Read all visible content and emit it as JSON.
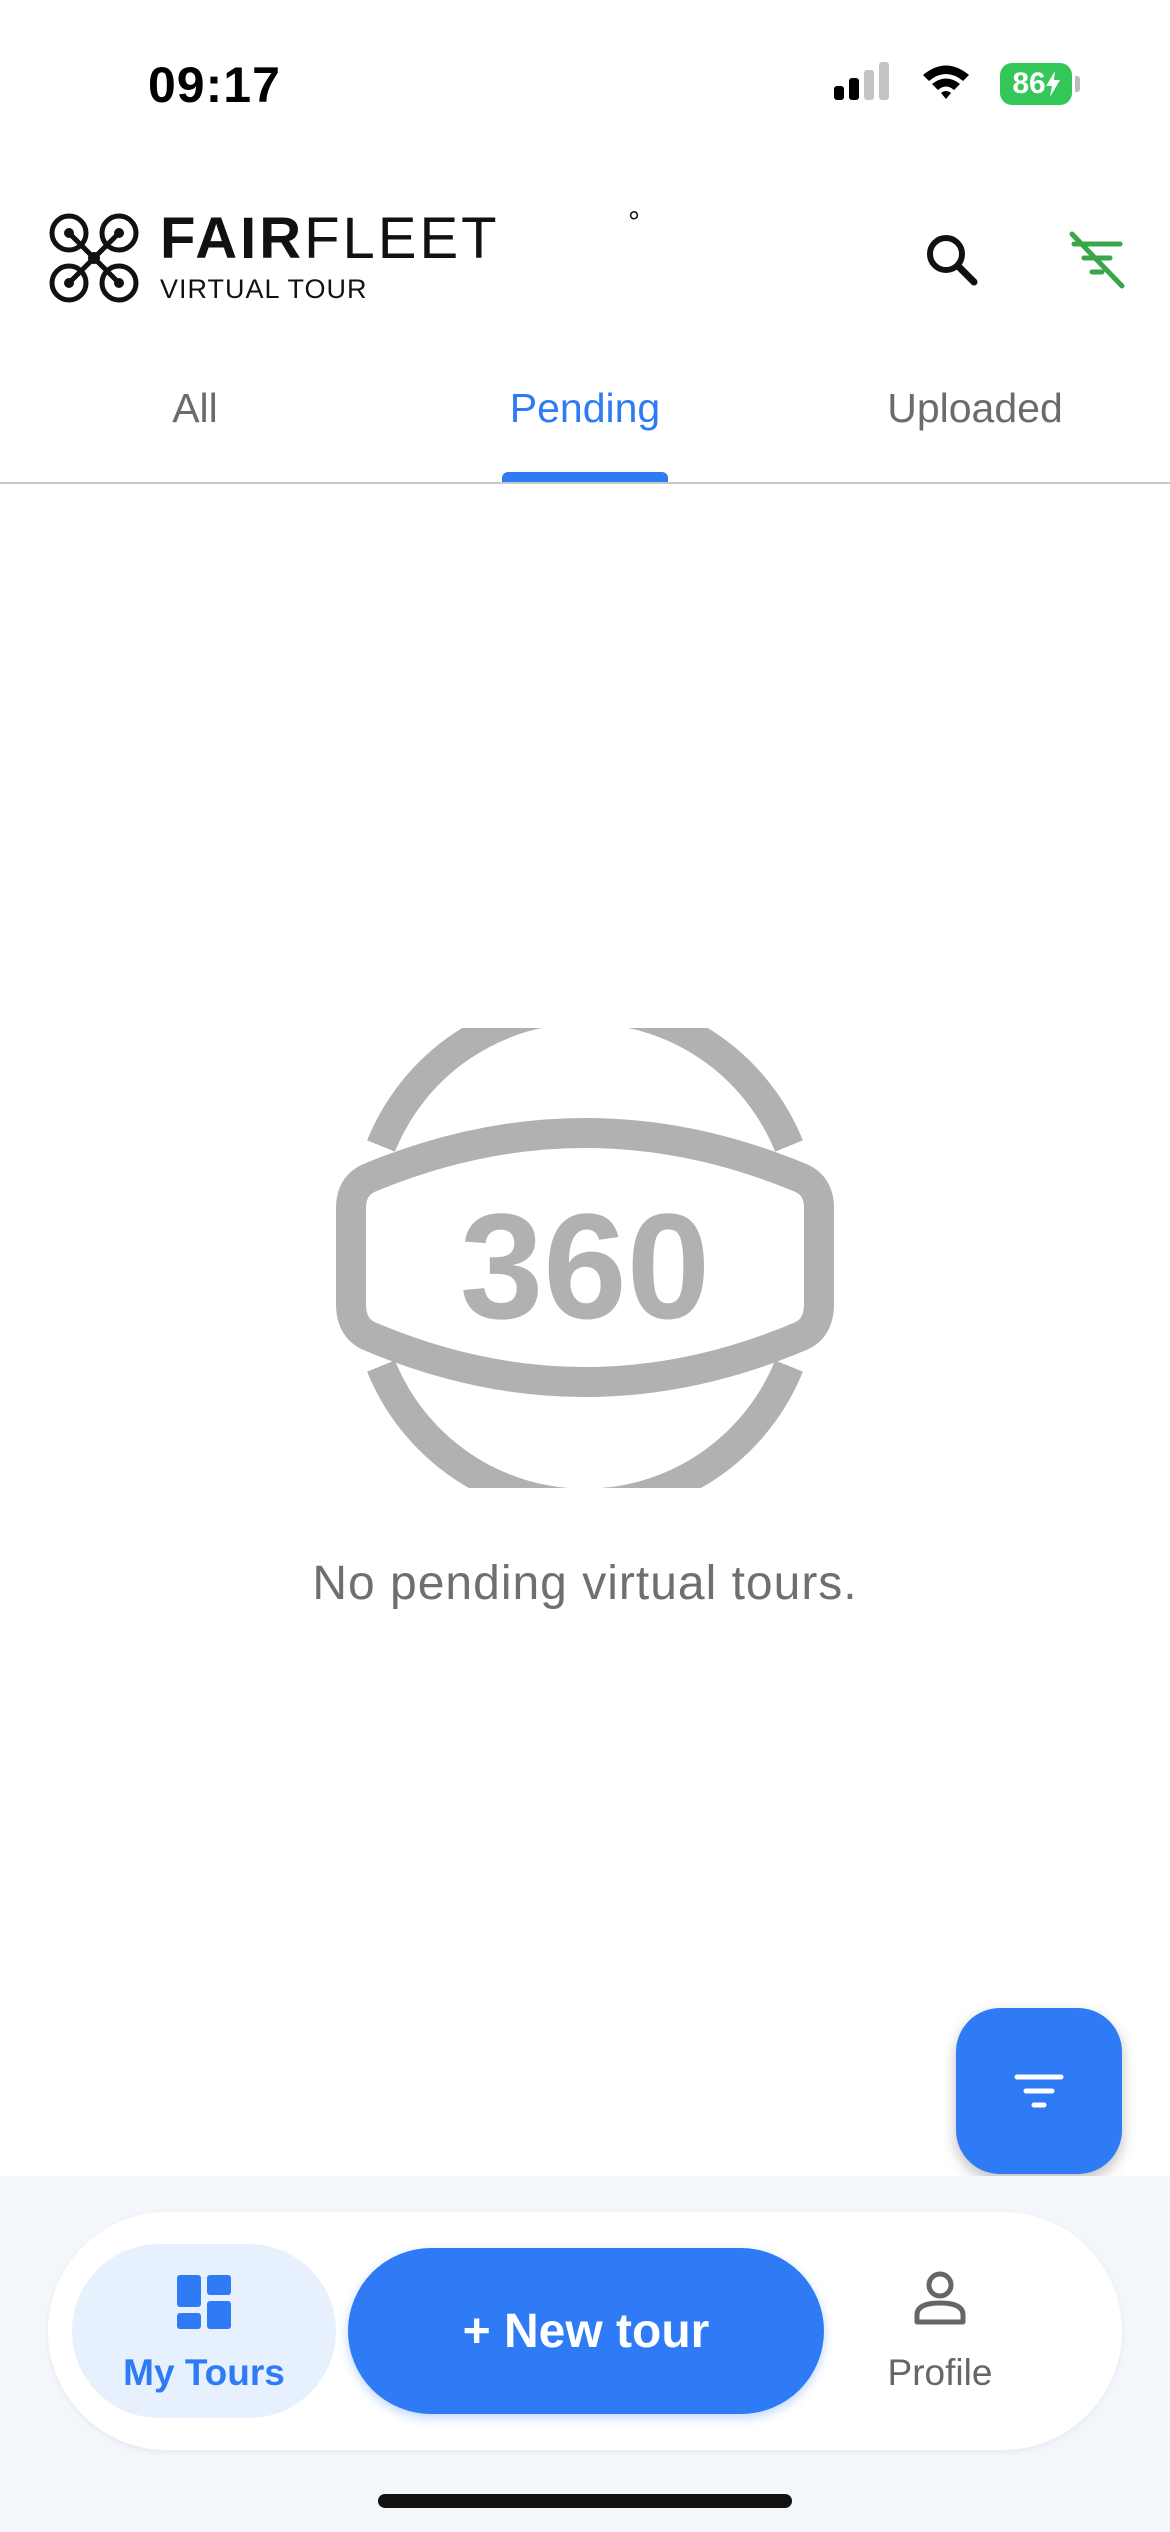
{
  "status_bar": {
    "time": "09:17",
    "battery": "86"
  },
  "header": {
    "brand_bold": "FAIR",
    "brand_light": "FLEET",
    "brand_mark": "°",
    "brand_sub": "VIRTUAL TOUR",
    "icons": [
      "search-icon",
      "filter-off-icon"
    ]
  },
  "tabs": [
    {
      "label": "All",
      "active": false
    },
    {
      "label": "Pending",
      "active": true
    },
    {
      "label": "Uploaded",
      "active": false
    }
  ],
  "empty_state": {
    "icon_text": "360",
    "message": "No pending virtual tours."
  },
  "fab": {
    "icon": "filter-icon"
  },
  "bottom_nav": {
    "my_tours": {
      "label": "My Tours",
      "icon": "dashboard-icon",
      "active": true
    },
    "new_tour": {
      "label": "+ New tour"
    },
    "profile": {
      "label": "Profile",
      "icon": "person-icon"
    }
  },
  "colors": {
    "accent": "#2f7bf5",
    "filter_off": "#3aa64a",
    "battery": "#34c759",
    "muted_icon": "#b3b3b3"
  }
}
